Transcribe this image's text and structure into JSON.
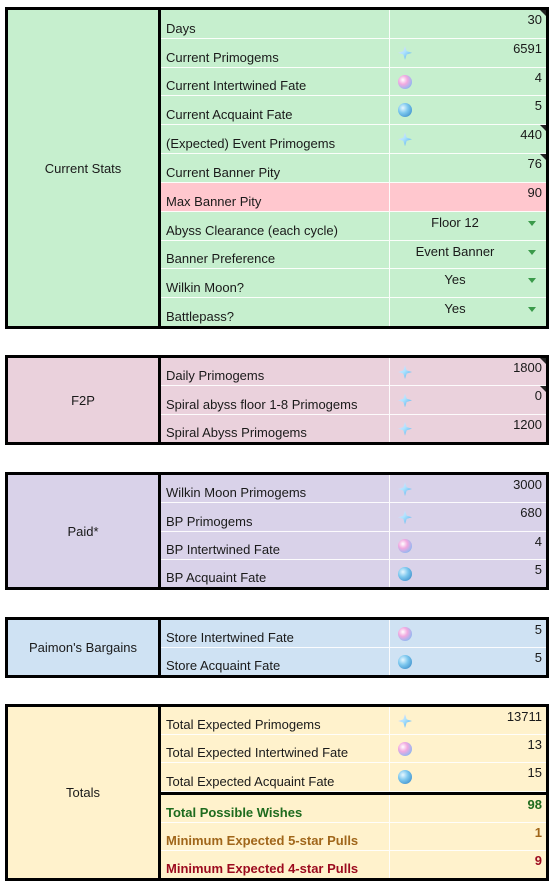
{
  "sections": {
    "current_stats": {
      "label": "Current Stats",
      "rows": [
        {
          "name": "Days",
          "value": "30"
        },
        {
          "name": "Current Primogems",
          "icon": "primogem-icon",
          "value": "6591"
        },
        {
          "name": "Current Intertwined Fate",
          "icon": "intertwined-fate-icon",
          "value": "4"
        },
        {
          "name": "Current Acquaint Fate",
          "icon": "acquaint-fate-icon",
          "value": "5"
        },
        {
          "name": "(Expected) Event Primogems",
          "icon": "primogem-icon",
          "value": "440"
        },
        {
          "name": "Current Banner Pity",
          "value": "76"
        },
        {
          "name": "Max Banner Pity",
          "value": "90"
        },
        {
          "name": "Abyss Clearance (each cycle)",
          "value": "Floor 12"
        },
        {
          "name": "Banner Preference",
          "value": "Event Banner"
        },
        {
          "name": "Wilkin Moon?",
          "value": "Yes"
        },
        {
          "name": "Battlepass?",
          "value": "Yes"
        }
      ]
    },
    "f2p": {
      "label": "F2P",
      "rows": [
        {
          "name": "Daily Primogems",
          "icon": "primogem-icon",
          "value": "1800"
        },
        {
          "name": "Spiral abyss floor 1-8 Primogems",
          "icon": "primogem-icon",
          "value": "0"
        },
        {
          "name": "Spiral Abyss Primogems",
          "icon": "primogem-icon",
          "value": "1200"
        }
      ]
    },
    "paid": {
      "label": "Paid*",
      "rows": [
        {
          "name": "Wilkin Moon Primogems",
          "icon": "primogem-icon",
          "value": "3000"
        },
        {
          "name": "BP Primogems",
          "icon": "primogem-icon",
          "value": "680"
        },
        {
          "name": "BP Intertwined Fate",
          "icon": "intertwined-fate-icon",
          "value": "4"
        },
        {
          "name": "BP Acquaint Fate",
          "icon": "acquaint-fate-icon",
          "value": "5"
        }
      ]
    },
    "paimon": {
      "label": "Paimon's Bargains",
      "rows": [
        {
          "name": "Store Intertwined Fate",
          "icon": "intertwined-fate-icon",
          "value": "5"
        },
        {
          "name": "Store Acquaint Fate",
          "icon": "acquaint-fate-icon",
          "value": "5"
        }
      ]
    },
    "totals": {
      "label": "Totals",
      "rows": [
        {
          "name": "Total Expected Primogems",
          "icon": "primogem-icon",
          "value": "13711"
        },
        {
          "name": "Total Expected Intertwined Fate",
          "icon": "intertwined-fate-icon",
          "value": "13"
        },
        {
          "name": "Total Expected Acquaint Fate",
          "icon": "acquaint-fate-icon",
          "value": "15"
        },
        {
          "name": "Total Possible Wishes",
          "value": "98"
        },
        {
          "name": "Minimum Expected 5-star Pulls",
          "value": "1"
        },
        {
          "name": "Minimum Expected 4-star Pulls",
          "value": "9"
        }
      ]
    }
  },
  "colors": {
    "current_stats_bg": "#c6efce",
    "highlight_row_bg": "#ffc7ce",
    "f2p_bg": "#ead1dc",
    "paid_bg": "#d9d2e9",
    "paimon_bg": "#cfe2f3",
    "totals_bg": "#fff2cc",
    "wishes_text": "#1e6b1e",
    "five_star_text": "#a0661a",
    "four_star_text": "#9c0a1e",
    "dropdown_arrow": "#3a9a4a"
  }
}
